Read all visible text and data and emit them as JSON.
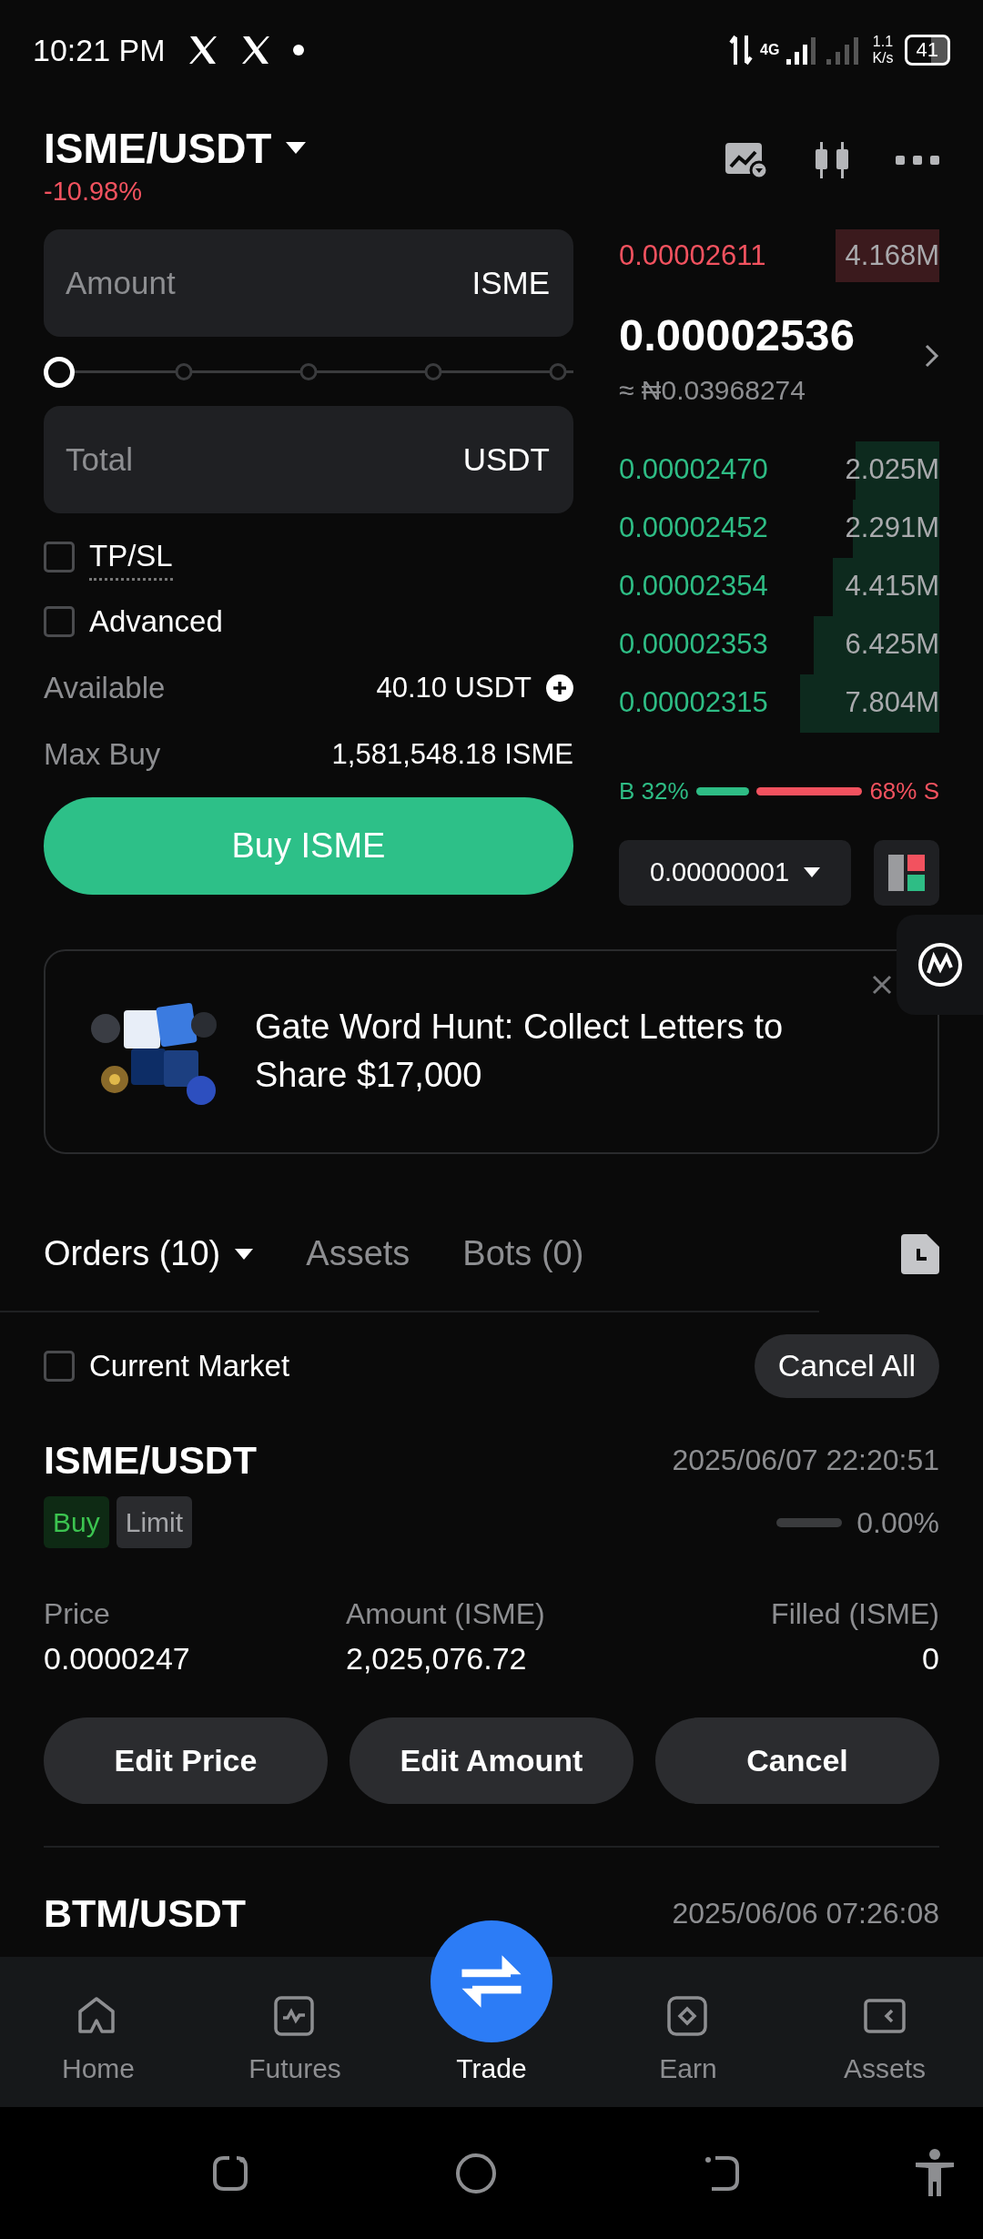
{
  "status_bar": {
    "time": "10:21 PM",
    "network": "4G",
    "speed": "1.1",
    "speed_unit": "K/s",
    "battery": "41"
  },
  "header": {
    "pair": "ISME/USDT",
    "change": "-10.98%"
  },
  "order_form": {
    "amount": {
      "placeholder": "Amount",
      "unit": "ISME"
    },
    "slider": {
      "level": 0
    },
    "total": {
      "placeholder": "Total",
      "unit": "USDT"
    },
    "options": [
      {
        "label": "TP/SL",
        "checked": false,
        "kind": "hint"
      },
      {
        "label": "Advanced",
        "checked": false,
        "kind": "plain"
      }
    ],
    "info": [
      {
        "label": "Available",
        "value": "40.10 USDT",
        "kind": "deposit"
      },
      {
        "label": "Max Buy",
        "value": "1,581,548.18 ISME",
        "kind": "plain"
      }
    ],
    "submit": "Buy ISME"
  },
  "order_book": {
    "asks": [
      {
        "price": "0.00002611",
        "size": "4.168M"
      }
    ],
    "last_price": "0.00002536",
    "fiat_price": "≈ ₦0.03968274",
    "bids": [
      {
        "price": "0.00002470",
        "size": "2.025M"
      },
      {
        "price": "0.00002452",
        "size": "2.291M"
      },
      {
        "price": "0.00002354",
        "size": "4.415M"
      },
      {
        "price": "0.00002353",
        "size": "6.425M"
      },
      {
        "price": "0.00002315",
        "size": "7.804M"
      }
    ],
    "ratio": {
      "buy_label": "B 32%",
      "sell_label": "68% S"
    },
    "precision": "0.00000001"
  },
  "banner": {
    "title": "Gate Word Hunt: Collect Letters to Share $17,000"
  },
  "tabs": [
    {
      "label": "Orders (10)",
      "selected": true
    },
    {
      "label": "Assets",
      "selected": false
    },
    {
      "label": "Bots (0)",
      "selected": false
    }
  ],
  "filter": {
    "label": "Current Market",
    "checked": false
  },
  "cancel_all": "Cancel All",
  "orders": [
    {
      "pair": "ISME/USDT",
      "time": "2025/06/07 22:20:51",
      "side": {
        "label": "Buy",
        "kind": "buy"
      },
      "type": "Limit",
      "progress": {
        "level": 0,
        "text": "0.00%"
      },
      "fields": [
        {
          "label": "Price",
          "value": "0.0000247"
        },
        {
          "label": "Amount (ISME)",
          "value": "2,025,076.72"
        },
        {
          "label": "Filled (ISME)",
          "value": "0"
        }
      ],
      "actions": [
        "Edit Price",
        "Edit Amount",
        "Cancel"
      ]
    },
    {
      "pair": "BTM/USDT",
      "time": "2025/06/06 07:26:08"
    }
  ],
  "bottom_nav": [
    {
      "label": "Home",
      "kind": "home",
      "selected": false
    },
    {
      "label": "Futures",
      "kind": "futures",
      "selected": false
    },
    {
      "label": "Trade",
      "kind": "trade",
      "selected": true
    },
    {
      "label": "Earn",
      "kind": "earn",
      "selected": false
    },
    {
      "label": "Assets",
      "kind": "assets",
      "selected": false
    }
  ]
}
